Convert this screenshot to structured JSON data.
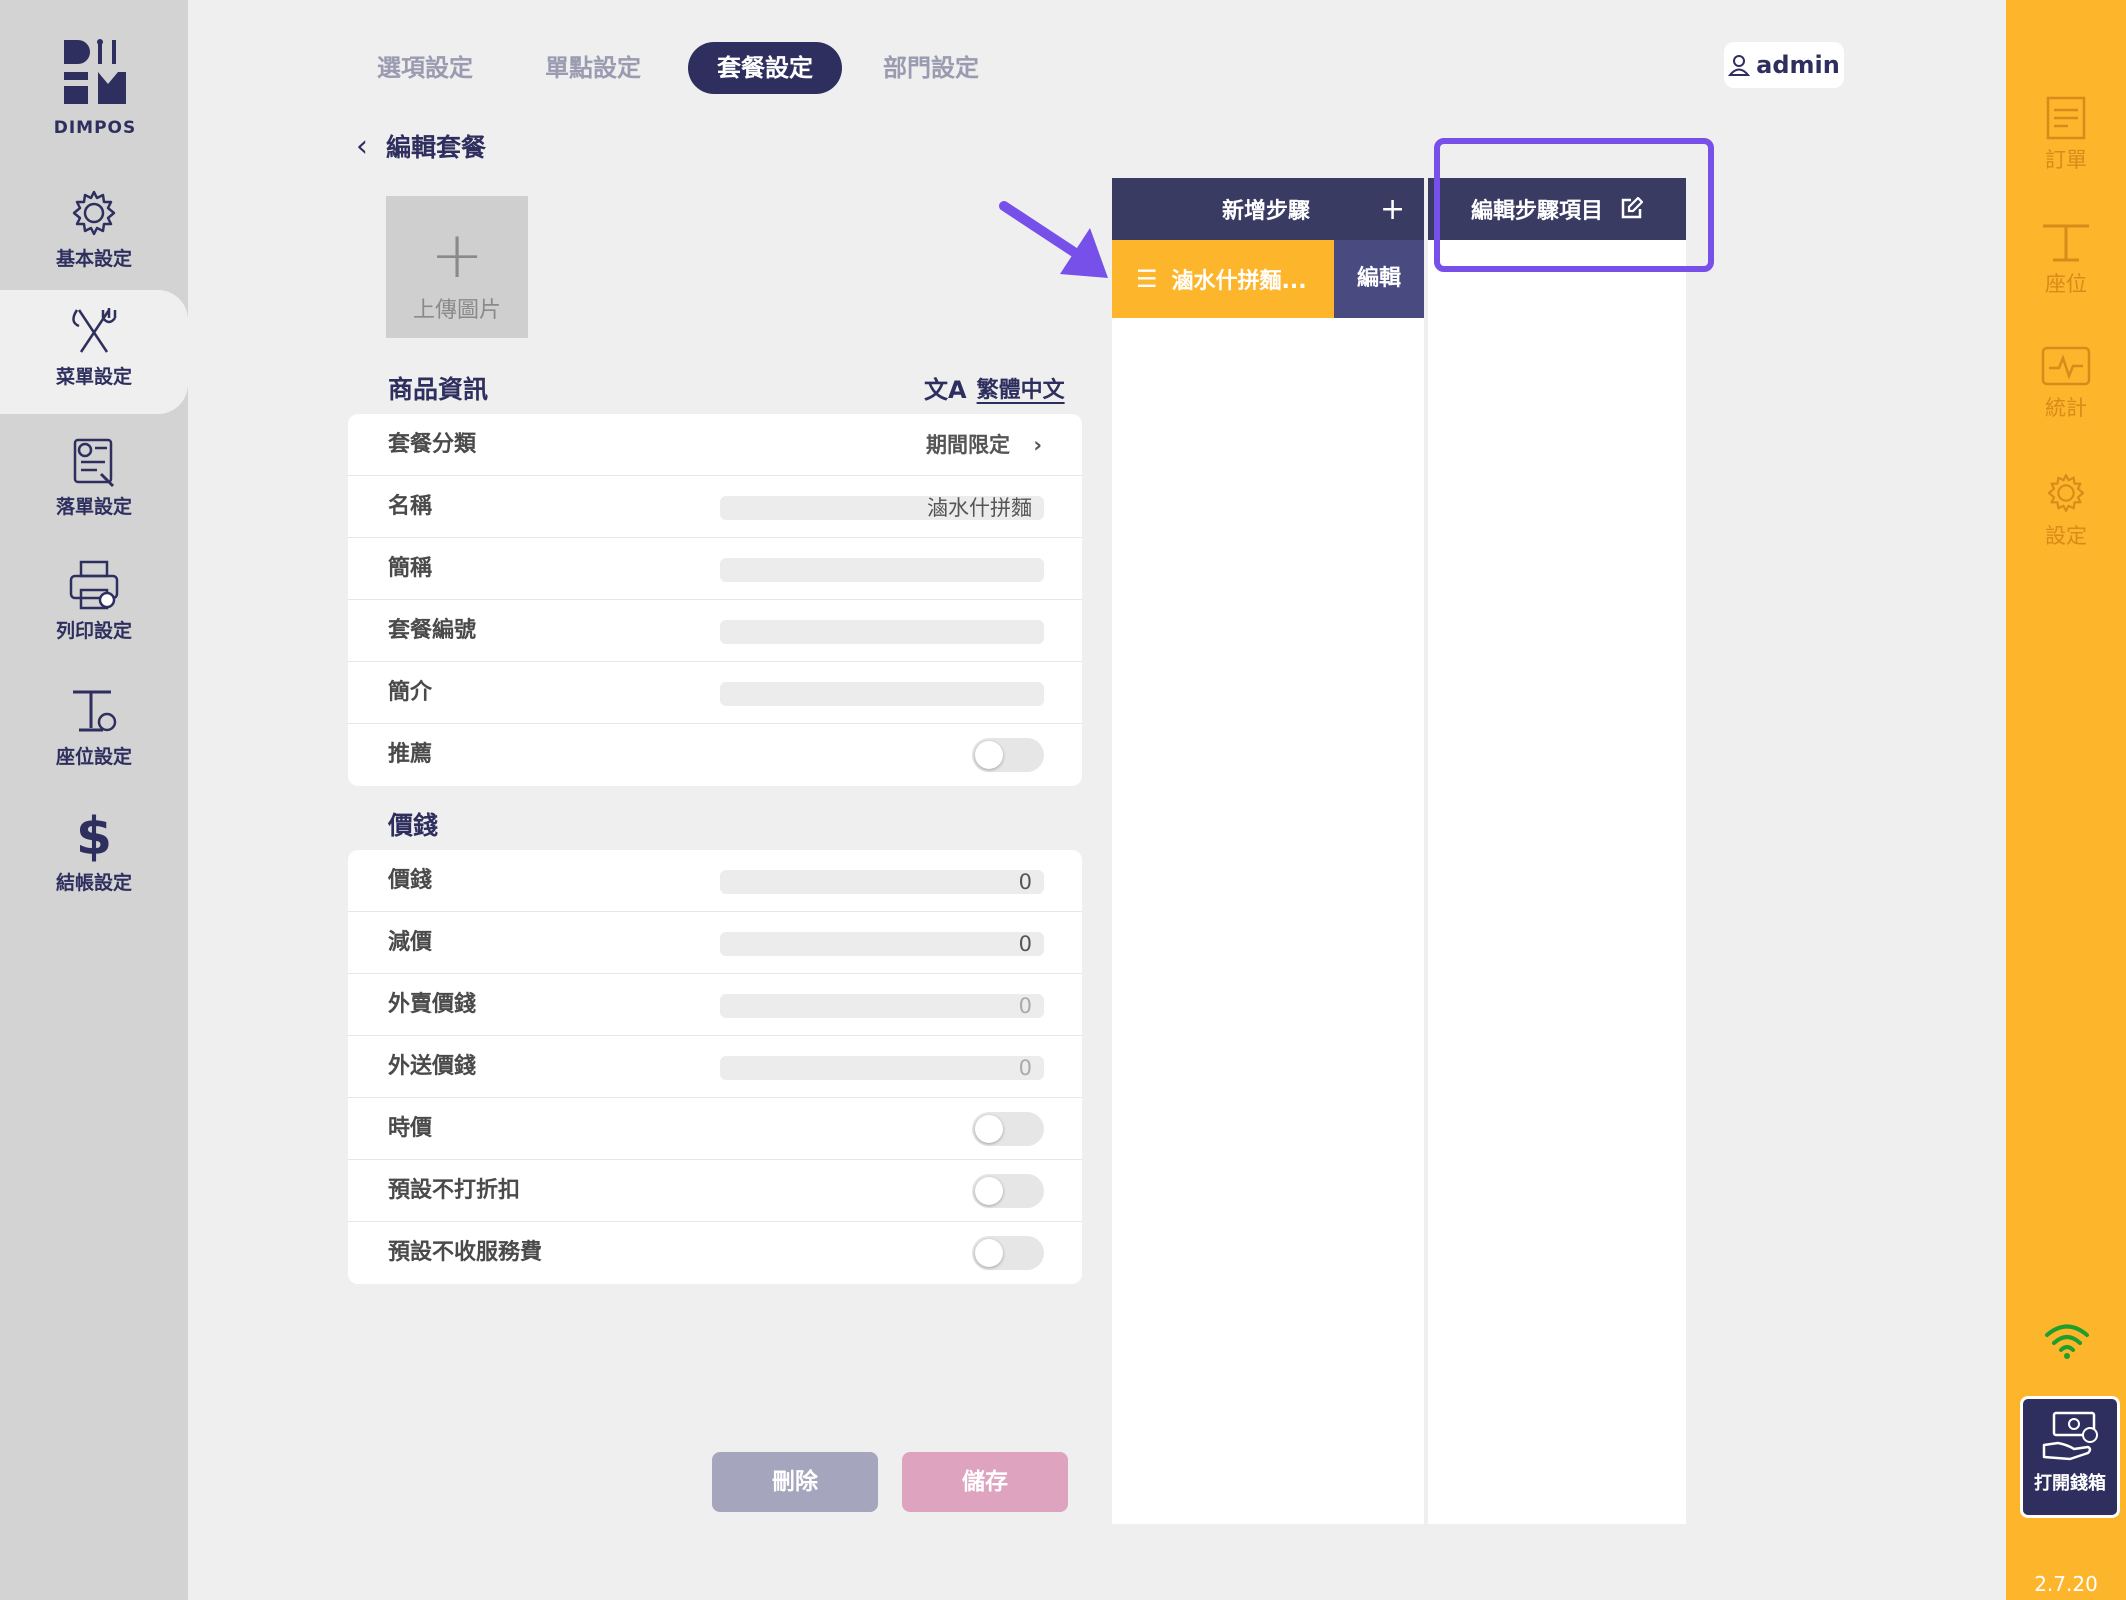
{
  "brand": {
    "name": "DIMPOS"
  },
  "left_nav": [
    {
      "label": "基本設定",
      "icon": "gear-icon"
    },
    {
      "label": "菜單設定",
      "icon": "fork-knife-icon",
      "active": true
    },
    {
      "label": "落單設定",
      "icon": "order-settings-icon"
    },
    {
      "label": "列印設定",
      "icon": "printer-icon"
    },
    {
      "label": "座位設定",
      "icon": "seat-settings-icon"
    },
    {
      "label": "結帳設定",
      "icon": "dollar-icon"
    }
  ],
  "tabs": [
    {
      "label": "選項設定"
    },
    {
      "label": "單點設定"
    },
    {
      "label": "套餐設定",
      "active": true
    },
    {
      "label": "部門設定"
    }
  ],
  "user": {
    "name": "admin"
  },
  "page": {
    "title": "編輯套餐"
  },
  "upload": {
    "label": "上傳圖片"
  },
  "product_info": {
    "title": "商品資訊",
    "language": "繁體中文",
    "rows": [
      {
        "label": "套餐分類",
        "value": "期間限定"
      },
      {
        "label": "名稱",
        "value": "滷水什拼麵"
      },
      {
        "label": "簡稱",
        "value": ""
      },
      {
        "label": "套餐編號",
        "value": ""
      },
      {
        "label": "簡介",
        "value": ""
      },
      {
        "label": "推薦",
        "toggle": false
      }
    ]
  },
  "price": {
    "title": "價錢",
    "rows": [
      {
        "label": "價錢",
        "value": "0"
      },
      {
        "label": "減價",
        "value": "0"
      },
      {
        "label": "外賣價錢",
        "value": "0"
      },
      {
        "label": "外送價錢",
        "value": "0"
      },
      {
        "label": "時價",
        "toggle": false
      },
      {
        "label": "預設不打折扣",
        "toggle": false
      },
      {
        "label": "預設不收服務費",
        "toggle": false
      }
    ]
  },
  "actions": {
    "delete": "刪除",
    "save": "儲存"
  },
  "steps_panel": {
    "add_label": "新增步驟",
    "steps": [
      {
        "name": "滷水什拼麵...",
        "edit": "編輯"
      }
    ]
  },
  "items_panel": {
    "title": "編輯步驟項目"
  },
  "right_nav": [
    {
      "label": "訂單",
      "icon": "order-icon"
    },
    {
      "label": "座位",
      "icon": "seat-icon"
    },
    {
      "label": "統計",
      "icon": "stats-icon"
    },
    {
      "label": "設定",
      "icon": "gear-icon"
    }
  ],
  "cash_drawer": {
    "label": "打開錢箱"
  },
  "version": "2.7.20",
  "colors": {
    "navy": "#2e2f5e",
    "orange": "#fdb52b",
    "highlight": "#7650e8"
  }
}
